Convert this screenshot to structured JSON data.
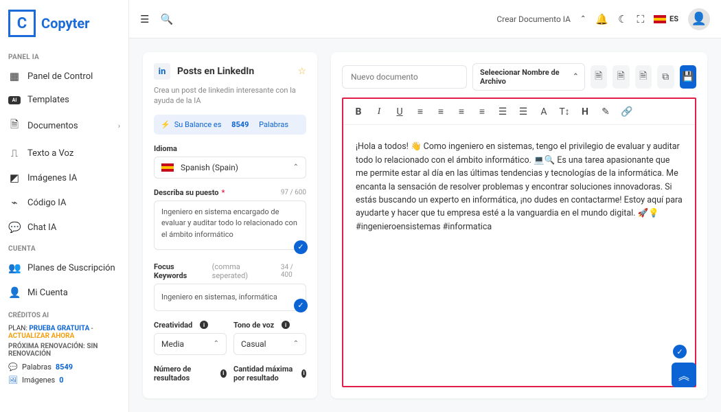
{
  "brand": {
    "letter": "C",
    "name": "Copyter"
  },
  "sidebar": {
    "sec_panel": "PANEL IA",
    "items": [
      {
        "label": "Panel de Control",
        "icon": "▦"
      },
      {
        "label": "Templates",
        "icon": "AI"
      },
      {
        "label": "Documentos",
        "icon": "🗎",
        "chev": "›"
      },
      {
        "label": "Texto a Voz",
        "icon": "⎍"
      },
      {
        "label": "Imágenes IA",
        "icon": "◩"
      },
      {
        "label": "Código IA",
        "icon": "⌁"
      },
      {
        "label": "Chat IA",
        "icon": "💬"
      }
    ],
    "sec_acct": "CUENTA",
    "acct": [
      {
        "label": "Planes de Suscripción",
        "icon": "👥"
      },
      {
        "label": "Mi Cuenta",
        "icon": "👤"
      }
    ],
    "credits": {
      "hdr": "CRÉDITOS AI",
      "plan_pre": "PLAN:",
      "plan_name": "PRUEBA GRATUITA",
      "dash": " - ",
      "update": "ACTUALIZAR AHORA",
      "renew": "PRÓXIMA RENOVACIÓN: SIN RENOVACIÓN",
      "rows": [
        {
          "lbl": "Palabras",
          "val": "8549"
        },
        {
          "lbl": "Imágenes",
          "val": "0"
        }
      ]
    }
  },
  "topbar": {
    "crear": "Crear Documento IA",
    "lang": "ES"
  },
  "form": {
    "title": "Posts en LinkedIn",
    "li": "in",
    "sub": "Crea un post de linkedin interesante con la ayuda de la IA",
    "balance_pre": "Su Balance es",
    "balance_num": "8549",
    "balance_post": "Palabras",
    "idioma_lbl": "Idioma",
    "idioma_val": "Spanish (Spain)",
    "desc_lbl": "Describa su puesto",
    "desc_count": "97 / 600",
    "desc_val": "Ingeniero en sistema encargado de evaluar y auditar todo lo relacionado con el ámbito informático",
    "focus_lbl": "Focus Keywords",
    "focus_hint": "(comma seperated)",
    "focus_count": "34 / 400",
    "focus_val": "Ingeniero en sistemas, informática",
    "creat_lbl": "Creatividad",
    "creat_val": "Media",
    "tono_lbl": "Tono de voz",
    "tono_val": "Casual",
    "num_lbl": "Número de resultados",
    "max_lbl": "Cantidad máxima por resultado"
  },
  "doc": {
    "new_ph": "Nuevo documento",
    "file_sel": "Seleecionar Nombre de Archivo",
    "text": "¡Hola a todos! 👋 Como ingeniero en sistemas, tengo el privilegio de evaluar y auditar todo lo relacionado con el ámbito informático. 💻🔍 Es una tarea apasionante que me permite estar al día en las últimas tendencias y tecnologías de la informática. Me encanta la sensación de resolver problemas y encontrar soluciones innovadoras. Si estás buscando un experto en informática, ¡no dudes en contactarme! Estoy aquí para ayudarte y hacer que tu empresa esté a la vanguardia en el mundo digital. 🚀💡 #ingenieroensistemas #informatica"
  }
}
